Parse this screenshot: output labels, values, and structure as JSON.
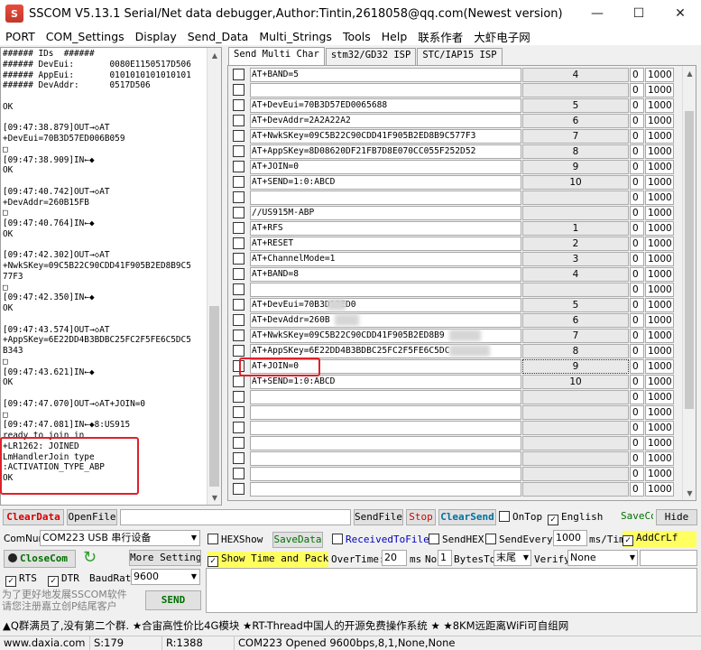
{
  "window": {
    "title": "SSCOM V5.13.1 Serial/Net data debugger,Author:Tintin,2618058@qq.com(Newest version)",
    "icon_letter": "S",
    "minimize": "—",
    "maximize": "☐",
    "close": "✕"
  },
  "menu": [
    "PORT",
    "COM_Settings",
    "Display",
    "Send_Data",
    "Multi_Strings",
    "Tools",
    "Help",
    "联系作者",
    "大虾电子网"
  ],
  "console": {
    "lines": [
      "###### IDs  ######",
      "###### DevEui:       0080E1150517D506",
      "###### AppEui:       0101010101010101",
      "###### DevAddr:      0517D506",
      "",
      "OK",
      "",
      "[09:47:38.879]OUT→◇AT",
      "+DevEui=70B3D57ED006B059",
      "□",
      "[09:47:38.909]IN←◆",
      "OK",
      "",
      "[09:47:40.742]OUT→◇AT",
      "+DevAddr=260B15FB",
      "□",
      "[09:47:40.764]IN←◆",
      "OK",
      "",
      "[09:47:42.302]OUT→◇AT",
      "+NwkSKey=09C5B22C90CDD41F905B2ED8B9C5",
      "77F3",
      "□",
      "[09:47:42.350]IN←◆",
      "OK",
      "",
      "[09:47:43.574]OUT→◇AT",
      "+AppSKey=6E22DD4B3BDBC25FC2F5FE6C5DC5",
      "B343",
      "□",
      "[09:47:43.621]IN←◆",
      "OK",
      "",
      "[09:47:47.070]OUT→◇AT+JOIN=0",
      "□",
      "[09:47:47.081]IN←◆8:US915",
      "ready to join in",
      "+LR1262: JOINED",
      "LmHandlerJoin type",
      ":ACTIVATION_TYPE_ABP",
      "OK"
    ]
  },
  "tabs": [
    "Send Multi Char",
    "stm32/GD32 ISP",
    "STC/IAP15 ISP"
  ],
  "multi_rows": [
    {
      "cmd": "AT+BAND=5",
      "btn": "4",
      "ord": "0",
      "delay": "1000"
    },
    {
      "cmd": "",
      "btn": "",
      "ord": "0",
      "delay": "1000"
    },
    {
      "cmd": "AT+DevEui=70B3D57ED0065688",
      "btn": "5",
      "ord": "0",
      "delay": "1000"
    },
    {
      "cmd": "AT+DevAddr=2A2A22A2",
      "btn": "6",
      "ord": "0",
      "delay": "1000"
    },
    {
      "cmd": "AT+NwkSKey=09C5B22C90CDD41F905B2ED8B9C577F3",
      "btn": "7",
      "ord": "0",
      "delay": "1000"
    },
    {
      "cmd": "AT+AppSKey=8D08620DF21FB7D8E070CC055F252D52",
      "btn": "8",
      "ord": "0",
      "delay": "1000"
    },
    {
      "cmd": "AT+JOIN=0",
      "btn": "9",
      "ord": "0",
      "delay": "1000"
    },
    {
      "cmd": "AT+SEND=1:0:ABCD",
      "btn": "10",
      "ord": "0",
      "delay": "1000"
    },
    {
      "cmd": "",
      "btn": "",
      "ord": "0",
      "delay": "1000"
    },
    {
      "cmd": "//US915M-ABP",
      "btn": "",
      "ord": "0",
      "delay": "1000"
    },
    {
      "cmd": "AT+RFS",
      "btn": "1",
      "ord": "0",
      "delay": "1000"
    },
    {
      "cmd": "AT+RESET",
      "btn": "2",
      "ord": "0",
      "delay": "1000"
    },
    {
      "cmd": "AT+ChannelMode=1",
      "btn": "3",
      "ord": "0",
      "delay": "1000"
    },
    {
      "cmd": "AT+BAND=8",
      "btn": "4",
      "ord": "0",
      "delay": "1000"
    },
    {
      "cmd": "",
      "btn": "",
      "ord": "0",
      "delay": "1000"
    },
    {
      "cmd": "AT+DevEui=70B3D57ED0",
      "btn": "5",
      "ord": "0",
      "delay": "1000"
    },
    {
      "cmd": "AT+DevAddr=260B",
      "btn": "6",
      "ord": "0",
      "delay": "1000"
    },
    {
      "cmd": "AT+NwkSKey=09C5B22C90CDD41F905B2ED8B9",
      "btn": "7",
      "ord": "0",
      "delay": "1000"
    },
    {
      "cmd": "AT+AppSKey=6E22DD4B3BDBC25FC2F5FE6C5DC",
      "btn": "8",
      "ord": "0",
      "delay": "1000"
    },
    {
      "cmd": "AT+JOIN=0",
      "btn": "9",
      "ord": "0",
      "delay": "1000"
    },
    {
      "cmd": "AT+SEND=1:0:ABCD",
      "btn": "10",
      "ord": "0",
      "delay": "1000"
    },
    {
      "cmd": "",
      "btn": "",
      "ord": "0",
      "delay": "1000"
    },
    {
      "cmd": "",
      "btn": "",
      "ord": "0",
      "delay": "1000"
    },
    {
      "cmd": "",
      "btn": "",
      "ord": "0",
      "delay": "1000"
    },
    {
      "cmd": "",
      "btn": "",
      "ord": "0",
      "delay": "1000"
    },
    {
      "cmd": "",
      "btn": "",
      "ord": "0",
      "delay": "1000"
    },
    {
      "cmd": "",
      "btn": "",
      "ord": "0",
      "delay": "1000"
    },
    {
      "cmd": "",
      "btn": "",
      "ord": "0",
      "delay": "1000"
    }
  ],
  "toolbar": {
    "clear_data": "ClearData",
    "open_file": "OpenFile",
    "send_file": "SendFile",
    "stop": "Stop",
    "clear_send": "ClearSend",
    "ontop": "OnTop",
    "english": "English",
    "save_config": "SaveConfig",
    "hide": "Hide"
  },
  "port": {
    "comnum_label": "ComNum",
    "comnum_value": "COM223 USB 串行设备",
    "close_com": "CloseCom",
    "more_settings": "More Settings",
    "rts": "RTS",
    "dtr": "DTR",
    "baudrate_label": "BaudRat",
    "baudrate_value": "9600"
  },
  "options": {
    "hexshow": "HEXShow",
    "savedata": "SaveData",
    "received_to_file": "ReceivedToFile",
    "sendhex": "SendHEX",
    "send_every": "SendEvery:",
    "send_every_value": "1000",
    "ms_tim": "ms/Tim",
    "add_crlf": "AddCrLf",
    "show_time": "Show Time and Packe",
    "overtime": "OverTime:",
    "overtime_value": "20",
    "ms": "ms",
    "no": "No",
    "no_value": "1",
    "bytes_to": "BytesTo",
    "bytes_to_value": "末尾",
    "verify": "Verify",
    "verify_value": "None"
  },
  "promo": {
    "line1": "为了更好地发展SSCOM软件",
    "line2": "请您注册嘉立创P结尾客户",
    "send": "SEND"
  },
  "ticker": "▲Q群满员了,没有第二个群. ★合宙高性价比4G模块 ★RT-Thread中国人的开源免费操作系统 ★ ★8KM远距离WiFi可自组网",
  "status": {
    "site": "www.daxia.com",
    "sent": "S:179",
    "recv": "R:1388",
    "port_state": "COM223 Opened  9600bps,8,1,None,None"
  },
  "colors": {
    "highlight": "#e0202a",
    "accent_red": "#d40000",
    "accent_green": "#007000",
    "accent_blue": "#0000c0"
  }
}
